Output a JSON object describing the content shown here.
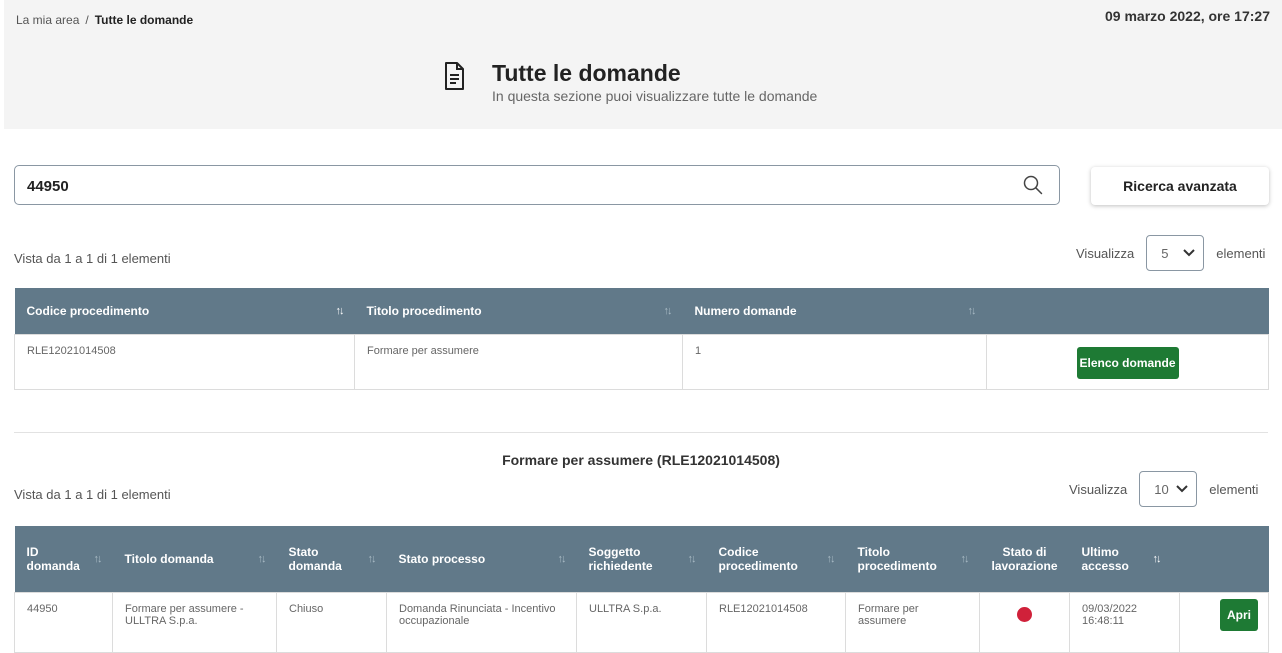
{
  "breadcrumb": {
    "home": "La mia area",
    "separator": "/",
    "current": "Tutte le domande"
  },
  "datetime": "09 marzo 2022, ore 17:27",
  "page": {
    "title": "Tutte le domande",
    "subtitle": "In questa sezione puoi visualizzare tutte le domande"
  },
  "search": {
    "value": "44950",
    "advanced_label": "Ricerca avanzata"
  },
  "top_list": {
    "info": "Vista da 1 a 1 di 1 elementi",
    "show_label": "Visualizza",
    "show_value": "5",
    "elements_label": "elementi",
    "columns": [
      "Codice procedimento",
      "Titolo procedimento",
      "Numero domande"
    ],
    "rows": [
      {
        "codice": "RLE12021014508",
        "titolo": "Formare per assumere",
        "numero": "1",
        "action": "Elenco domande"
      }
    ]
  },
  "bottom_list": {
    "section_title": "Formare per assumere (RLE12021014508)",
    "info": "Vista da 1 a 1 di 1 elementi",
    "show_label": "Visualizza",
    "show_value": "10",
    "elements_label": "elementi",
    "columns": [
      "ID domanda",
      "Titolo domanda",
      "Stato domanda",
      "Stato processo",
      "Soggetto richiedente",
      "Codice procedimento",
      "Titolo procedimento",
      "Stato di lavorazione",
      "Ultimo accesso"
    ],
    "rows": [
      {
        "id": "44950",
        "titolo": "Formare per assumere - ULLTRA S.p.a.",
        "stato_domanda": "Chiuso",
        "stato_processo": "Domanda Rinunciata - Incentivo occupazionale",
        "soggetto": "ULLTRA S.p.a.",
        "codice": "RLE12021014508",
        "titolo_proc": "Formare per assumere",
        "stato_lavorazione_color": "#d0213a",
        "ultimo_accesso": "09/03/2022 16:48:11",
        "action": "Apri"
      }
    ]
  },
  "colors": {
    "table_header": "#617989",
    "primary_green": "#1e7a34",
    "status_red": "#d0213a"
  }
}
